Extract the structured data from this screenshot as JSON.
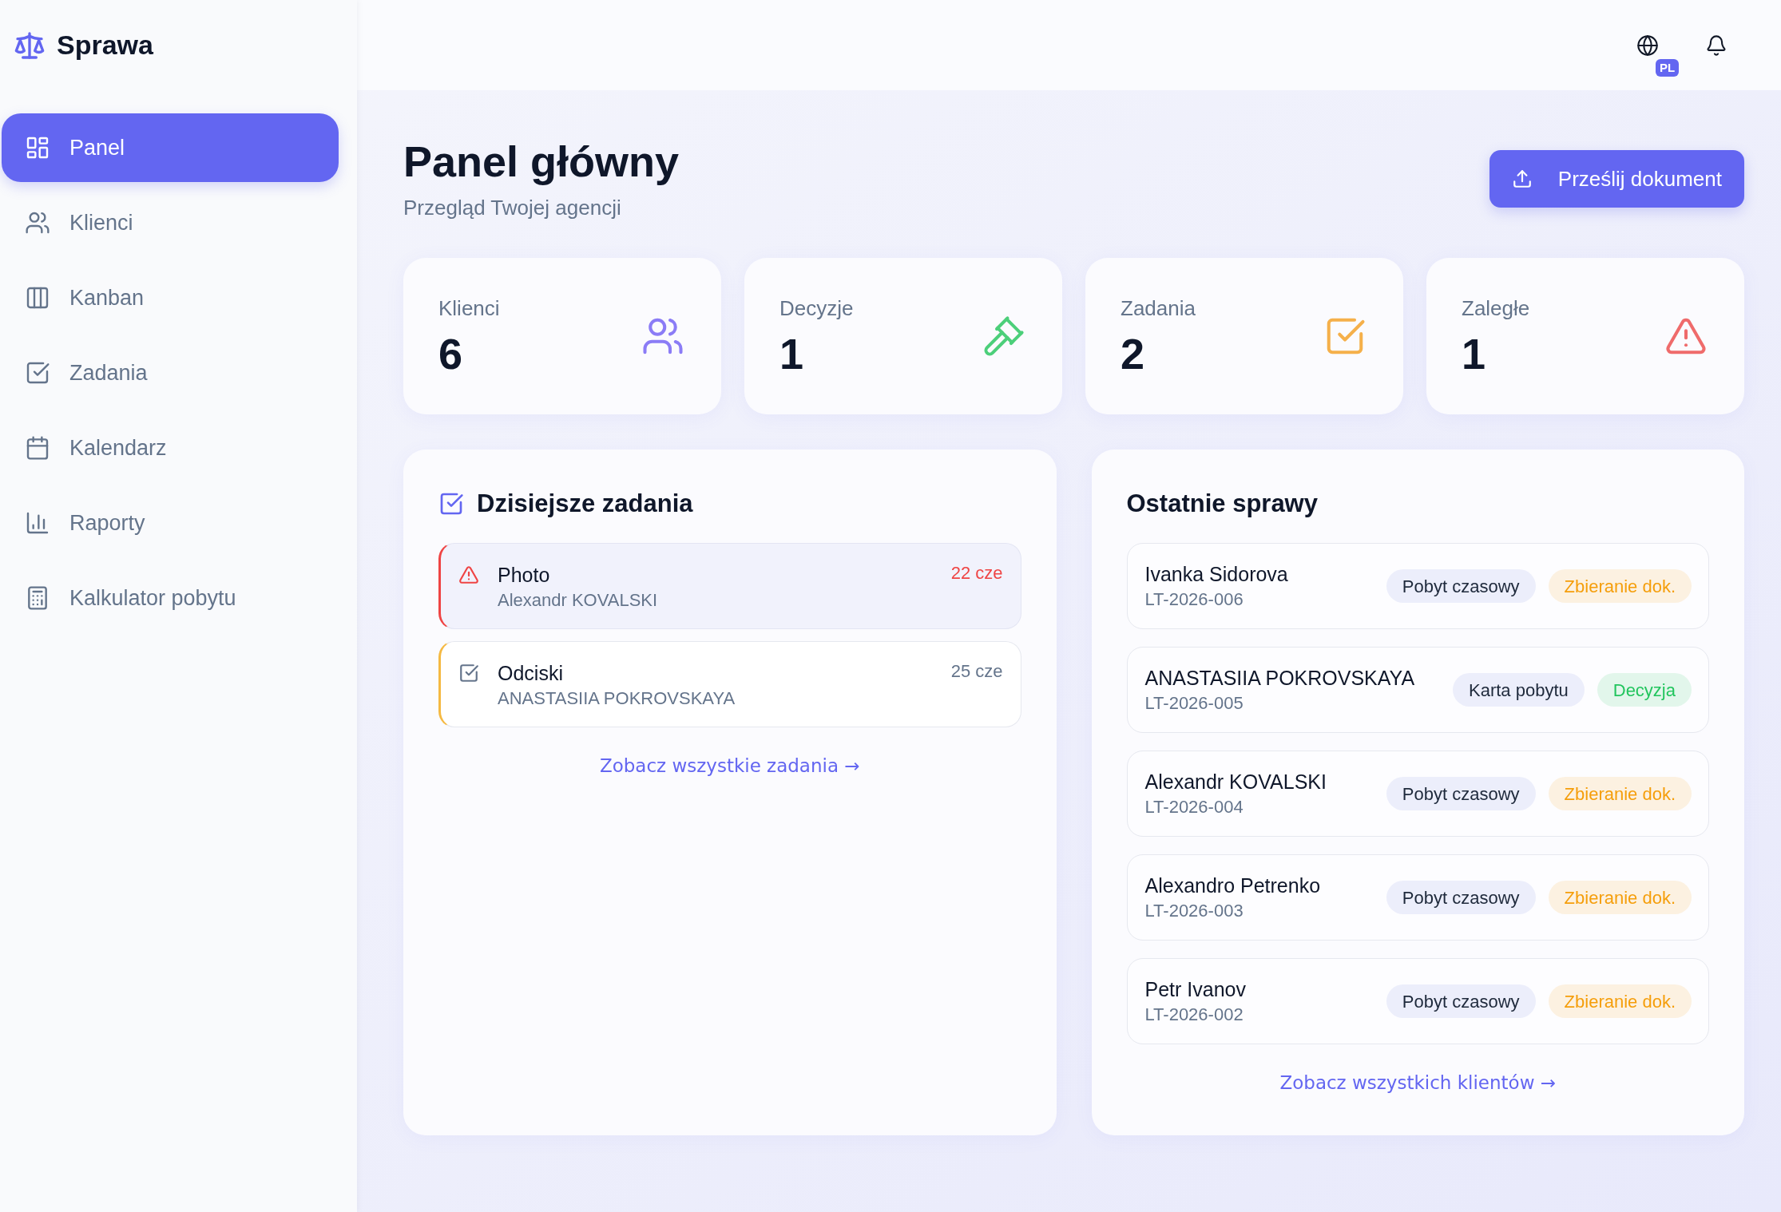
{
  "app": {
    "name": "Sprawa"
  },
  "nav": {
    "items": [
      {
        "label": "Panel",
        "selected": true
      },
      {
        "label": "Klienci",
        "selected": false
      },
      {
        "label": "Kanban",
        "selected": false
      },
      {
        "label": "Zadania",
        "selected": false
      },
      {
        "label": "Kalendarz",
        "selected": false
      },
      {
        "label": "Raporty",
        "selected": false
      },
      {
        "label": "Kalkulator pobytu",
        "selected": false
      }
    ]
  },
  "header": {
    "language": "PL"
  },
  "page": {
    "title": "Panel główny",
    "subtitle": "Przegląd Twojej agencji",
    "upload_button": "Prześlij dokument"
  },
  "stats": [
    {
      "label": "Klienci",
      "value": "6",
      "color": "#8b7cf6"
    },
    {
      "label": "Decyzje",
      "value": "1",
      "color": "#4ccf7a"
    },
    {
      "label": "Zadania",
      "value": "2",
      "color": "#f5b04a"
    },
    {
      "label": "Zaległe",
      "value": "1",
      "color": "#ef6b6b"
    }
  ],
  "tasks": {
    "title": "Dzisiejsze zadania",
    "items": [
      {
        "title": "Photo",
        "client": "Alexandr KOVALSKI",
        "date": "22 cze",
        "overdue": true
      },
      {
        "title": "Odciski",
        "client": "ANASTASIIA POKROVSKAYA",
        "date": "25 cze",
        "overdue": false
      }
    ],
    "link": "Zobacz wszystkie zadania →"
  },
  "cases": {
    "title": "Ostatnie sprawy",
    "items": [
      {
        "name": "Ivanka Sidorova",
        "code": "LT-2026-006",
        "type": "Pobyt czasowy",
        "status": {
          "label": "Zbieranie dok.",
          "color": "#f59e0b"
        }
      },
      {
        "name": "ANASTASIIA POKROVSKAYA",
        "code": "LT-2026-005",
        "type": "Karta pobytu",
        "status": {
          "label": "Decyzja",
          "color": "#22c55e"
        }
      },
      {
        "name": "Alexandr KOVALSKI",
        "code": "LT-2026-004",
        "type": "Pobyt czasowy",
        "status": {
          "label": "Zbieranie dok.",
          "color": "#f59e0b"
        }
      },
      {
        "name": "Alexandro Petrenko",
        "code": "LT-2026-003",
        "type": "Pobyt czasowy",
        "status": {
          "label": "Zbieranie dok.",
          "color": "#f59e0b"
        }
      },
      {
        "name": "Petr Ivanov",
        "code": "LT-2026-002",
        "type": "Pobyt czasowy",
        "status": {
          "label": "Zbieranie dok.",
          "color": "#f59e0b"
        }
      }
    ],
    "link": "Zobacz wszystkich klientów →"
  }
}
